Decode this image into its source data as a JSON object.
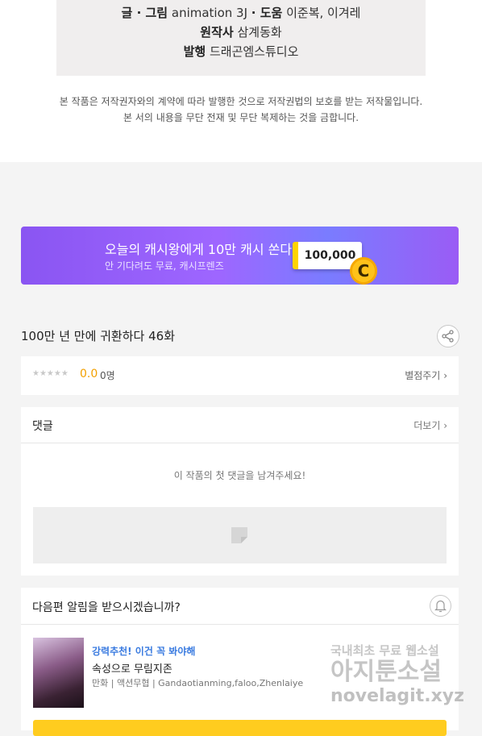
{
  "credits": {
    "art_label": "글 · 그림",
    "art_value": "animation 3J",
    "help_label": "· 도움",
    "help_value": "이준복, 이겨레",
    "original_label": "원작사",
    "original_value": "삼계동화",
    "publisher_label": "발행",
    "publisher_value": "드래곤엠스튜디오"
  },
  "notice": {
    "line1": "본 작품은 저작권자와의 계약에 따라 발행한 것으로 저작권법의 보호를 받는 저작물입니다.",
    "line2": "본 서의 내용을 무단 전재 및 무단 복제하는 것을 금합니다."
  },
  "banner": {
    "headline": "오늘의 캐시왕에게 10만 캐시 쏜다!",
    "subline": "안 기다려도 무료, 캐시프렌즈",
    "amount": "100,000",
    "coin_glyph": "C"
  },
  "episode": {
    "title": "100만 년 만에 귀환하다 46화",
    "stars": "★★★★★",
    "score": "0.0",
    "count": "0명",
    "rate_button": "별점주기"
  },
  "comments": {
    "label": "댓글",
    "more": "더보기",
    "empty_text": "이 작품의 첫 댓글을 남겨주세요!"
  },
  "notify": {
    "question": "다음편 알림을 받으시겠습니까?",
    "recommend_tag": "강력추천! 이건 꼭 봐야해",
    "recommend_title": "속성으로 무림지존",
    "recommend_genre": "만화",
    "recommend_subgenre": "액션무협",
    "recommend_authors": "Gandaotianming,faloo,Zhenlaiye"
  },
  "watermark": {
    "line1": "국내최초 무료 웹소설",
    "line2": "아지툰소설",
    "line3": "novelagit.xyz"
  },
  "colors": {
    "banner_start": "#8a55f2",
    "score": "#f2a000",
    "link_blue": "#3a7be0",
    "cta_yellow": "#ffcc1f"
  }
}
